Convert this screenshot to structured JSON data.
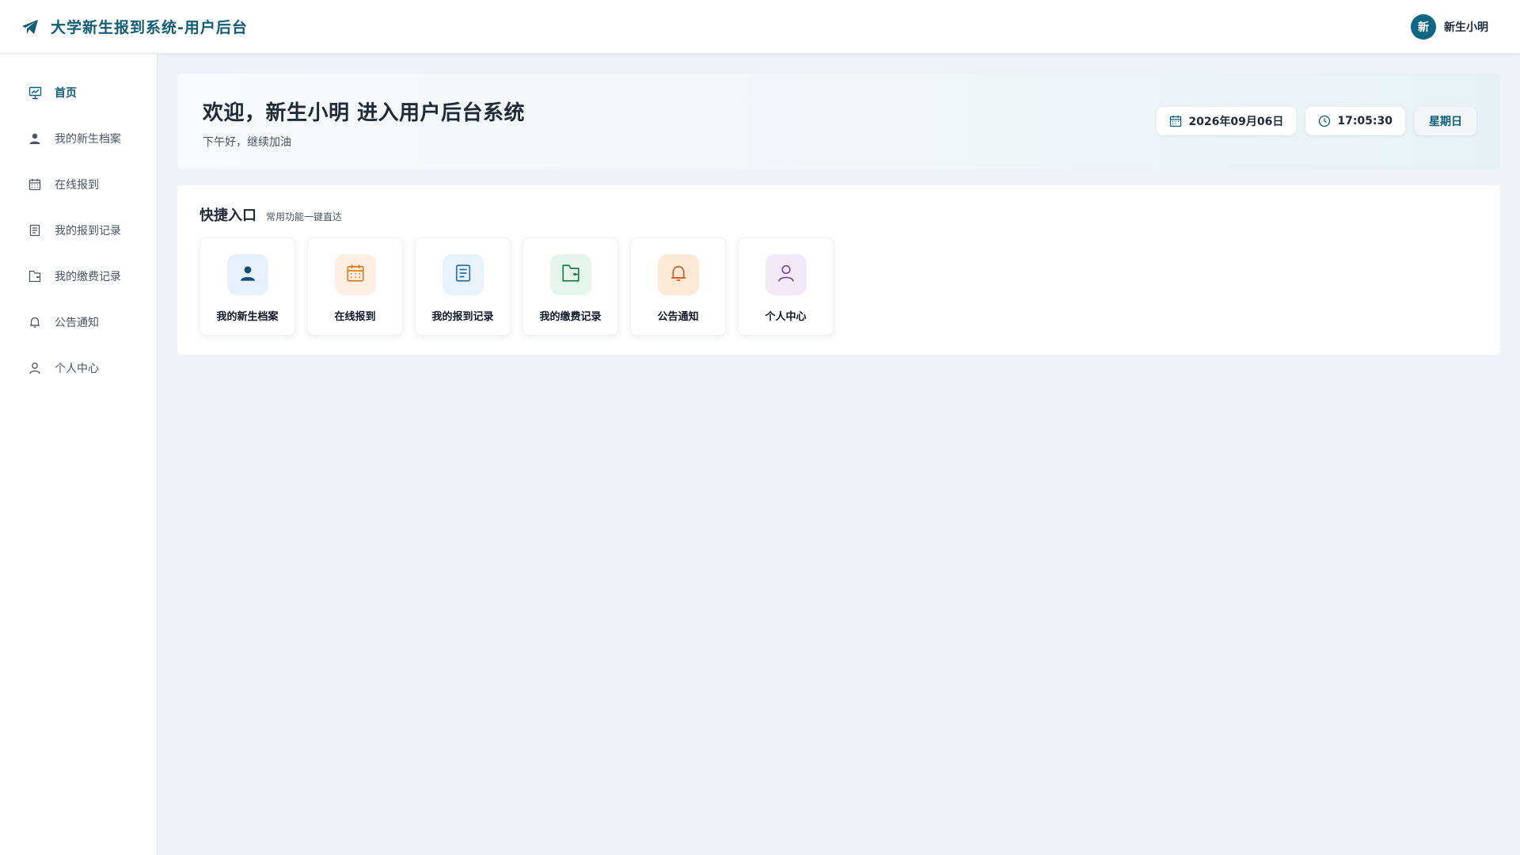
{
  "header": {
    "brand_icon": "paper-plane-icon",
    "title": "大学新生报到系统-用户后台",
    "user": {
      "avatar_text": "新",
      "name": "新生小明"
    }
  },
  "sidebar": {
    "items": [
      {
        "label": "首页",
        "icon": "presentation-board-icon",
        "active": true
      },
      {
        "label": "我的新生档案",
        "icon": "user-icon"
      },
      {
        "label": "在线报到",
        "icon": "calendar-icon"
      },
      {
        "label": "我的报到记录",
        "icon": "document-icon"
      },
      {
        "label": "我的缴费记录",
        "icon": "wallet-icon"
      },
      {
        "label": "公告通知",
        "icon": "bell-icon"
      },
      {
        "label": "个人中心",
        "icon": "user-outline-icon"
      }
    ]
  },
  "welcome": {
    "title": "欢迎，新生小明 进入用户后台系统",
    "subtitle": "下午好，继续加油",
    "date": "2026年09月06日",
    "time": "17:05:30",
    "weekday": "星期日"
  },
  "quick": {
    "title": "快捷入口",
    "subtitle": "常用功能一键直达",
    "cards": [
      {
        "label": "我的新生档案",
        "icon": "user-icon",
        "color": "#134d70",
        "bg": "#e6f1fb"
      },
      {
        "label": "在线报到",
        "icon": "calendar-icon",
        "color": "#e07a1a",
        "bg": "#fdf0e2"
      },
      {
        "label": "我的报到记录",
        "icon": "document-icon",
        "color": "#2f6fa8",
        "bg": "#e8f2fb"
      },
      {
        "label": "我的缴费记录",
        "icon": "wallet-icon",
        "color": "#1f7a47",
        "bg": "#e5f5ec"
      },
      {
        "label": "公告通知",
        "icon": "bell-icon",
        "color": "#d9591b",
        "bg": "#fde9d6"
      },
      {
        "label": "个人中心",
        "icon": "user-outline-icon",
        "color": "#7a4b95",
        "bg": "#f2e9f7"
      }
    ]
  },
  "colors": {
    "primary": "#0f5f78",
    "background": "#eff2f7"
  }
}
